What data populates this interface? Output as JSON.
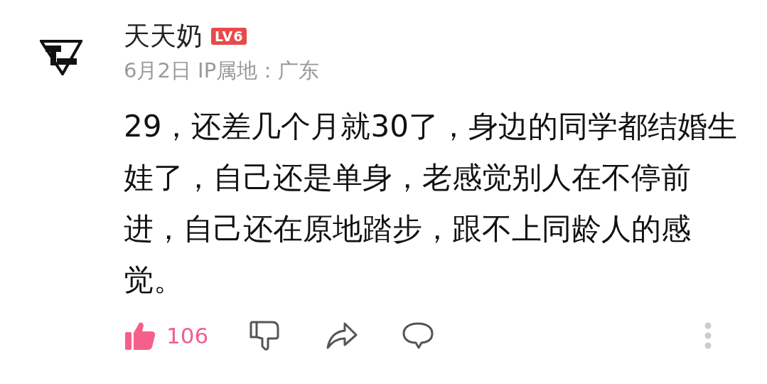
{
  "comment": {
    "username": "天天奶",
    "level_badge": "LV6",
    "meta": "6月2日 IP属地：广东",
    "body": "29，还差几个月就30了，身边的同学都结婚生娃了，自己还是单身，老感觉别人在不停前进，自己还在原地踏步，跟不上同龄人的感觉。",
    "likes": "106",
    "liked": true
  }
}
